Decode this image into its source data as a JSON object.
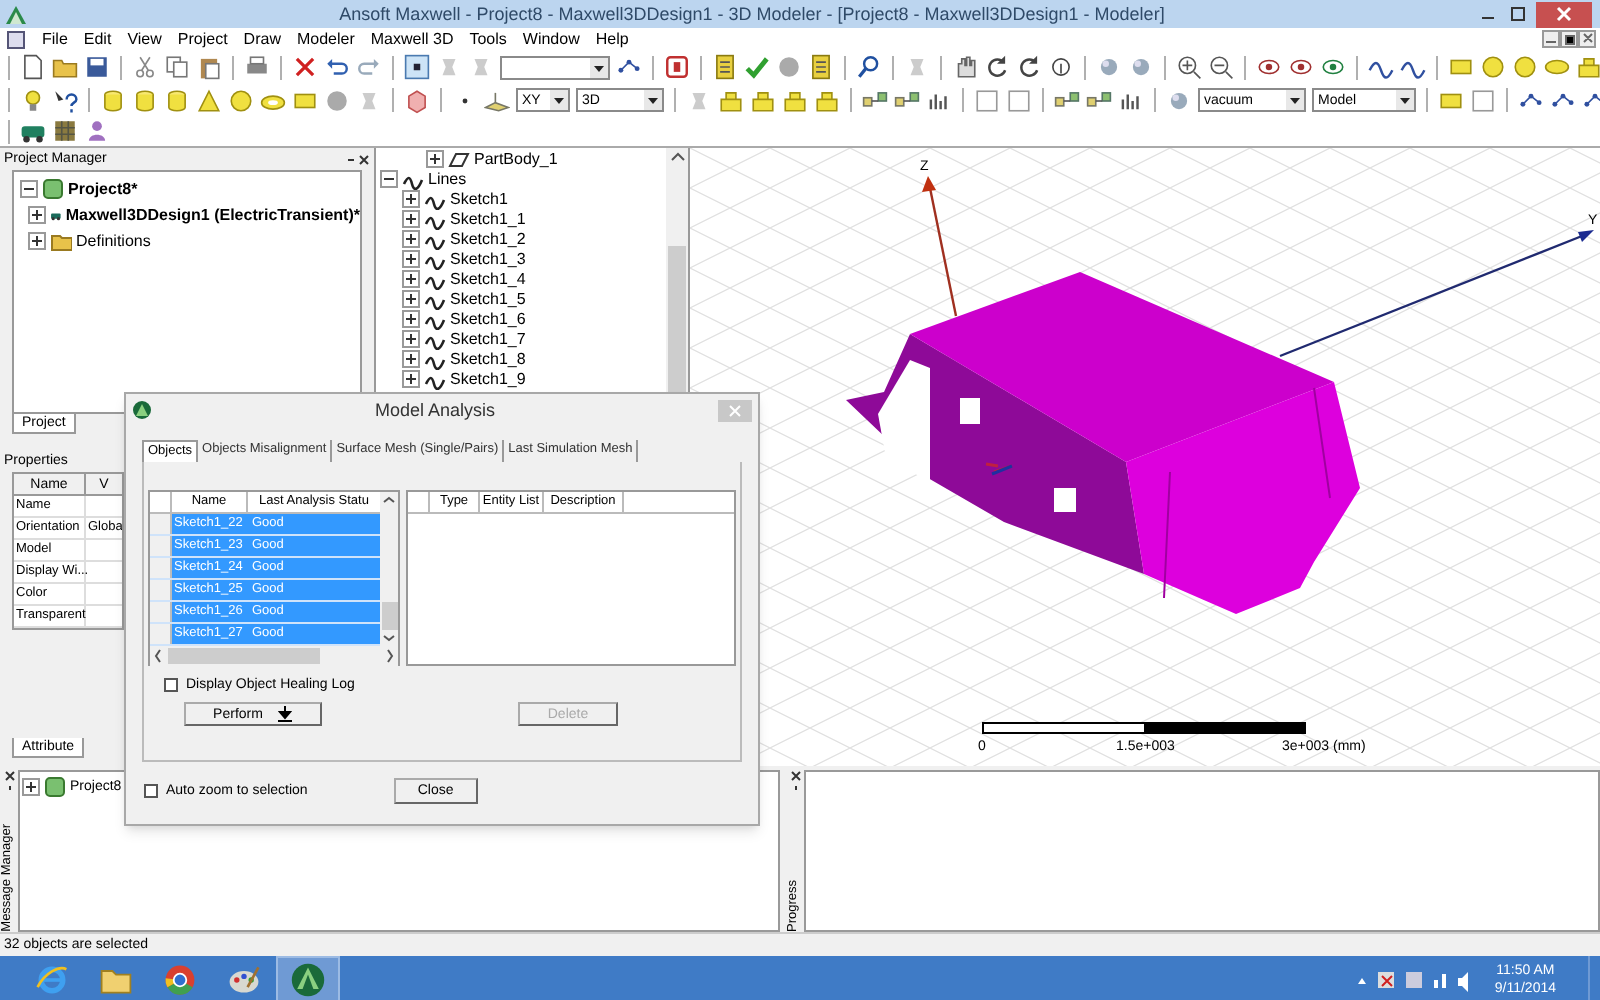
{
  "window": {
    "title": "Ansoft Maxwell  - Project8 - Maxwell3DDesign1 - 3D Modeler - [Project8 - Maxwell3DDesign1 - Modeler]"
  },
  "menu": [
    "File",
    "Edit",
    "View",
    "Project",
    "Draw",
    "Modeler",
    "Maxwell 3D",
    "Tools",
    "Window",
    "Help"
  ],
  "toolbar": {
    "plane": "XY",
    "view": "3D",
    "material": "vacuum",
    "mode": "Model"
  },
  "project_manager": {
    "title": "Project Manager",
    "tab": "Project",
    "tree": [
      {
        "label": "Project8*",
        "expanded": true,
        "children": [
          {
            "label": "Maxwell3DDesign1 (ElectricTransient)*",
            "expanded": false
          },
          {
            "label": "Definitions",
            "expanded": false
          }
        ]
      }
    ]
  },
  "properties": {
    "title": "Properties",
    "columns": [
      "Name",
      "V"
    ],
    "tab": "Attribute",
    "rows": [
      {
        "name": "Name"
      },
      {
        "name": "Orientation",
        "value": "Globa"
      },
      {
        "name": "Model"
      },
      {
        "name": "Display Wi..."
      },
      {
        "name": "Color"
      },
      {
        "name": "Transparent"
      }
    ]
  },
  "model_tree": [
    {
      "kind": "body",
      "label": "PartBody_1",
      "expanded": false
    },
    {
      "kind": "group",
      "label": "Lines",
      "expanded": true,
      "children": [
        {
          "label": "Sketch1",
          "expanded": false
        },
        {
          "label": "Sketch1_1",
          "expanded": false
        },
        {
          "label": "Sketch1_2",
          "expanded": false
        },
        {
          "label": "Sketch1_3",
          "expanded": false
        },
        {
          "label": "Sketch1_4",
          "expanded": false
        },
        {
          "label": "Sketch1_5",
          "expanded": false
        },
        {
          "label": "Sketch1_6",
          "expanded": false
        },
        {
          "label": "Sketch1_7",
          "expanded": false
        },
        {
          "label": "Sketch1_8",
          "expanded": false
        },
        {
          "label": "Sketch1_9",
          "expanded": false
        }
      ]
    }
  ],
  "view": {
    "axes": {
      "z": "Z",
      "y": "Y"
    },
    "scale_bar": [
      "0",
      "1.5e+003",
      "3e+003 (mm)"
    ]
  },
  "dialog": {
    "title": "Model Analysis",
    "tabs": [
      {
        "label": "Objects",
        "selected": true
      },
      {
        "label": "Objects Misalignment",
        "selected": false
      },
      {
        "label": "Surface Mesh (Single/Pairs)",
        "selected": false
      },
      {
        "label": "Last Simulation Mesh",
        "selected": false
      }
    ],
    "objects_table": {
      "columns": [
        "Name",
        "Last Analysis Statu"
      ],
      "rows": [
        {
          "name": "Sketch1_22",
          "status": "Good",
          "selected": true
        },
        {
          "name": "Sketch1_23",
          "status": "Good",
          "selected": true
        },
        {
          "name": "Sketch1_24",
          "status": "Good",
          "selected": true
        },
        {
          "name": "Sketch1_25",
          "status": "Good",
          "selected": true
        },
        {
          "name": "Sketch1_26",
          "status": "Good",
          "selected": true
        },
        {
          "name": "Sketch1_27",
          "status": "Good",
          "selected": true
        }
      ]
    },
    "details_table": {
      "columns": [
        "Type",
        "Entity List",
        "Description"
      ]
    },
    "healing_log": {
      "label": "Display Object Healing Log",
      "checked": false
    },
    "buttons": [
      {
        "label": "Perform",
        "disabled": false
      },
      {
        "label": "Delete",
        "disabled": true
      }
    ],
    "auto_zoom": {
      "label": "Auto zoom to selection",
      "checked": false
    },
    "close_button": "Close"
  },
  "message_manager": {
    "title": "Message Manager",
    "items": [
      {
        "label": "Project8",
        "expanded": false
      }
    ]
  },
  "progress": {
    "title": "Progress"
  },
  "status_bar": "32 objects are selected",
  "taskbar": {
    "apps": [
      {
        "kind": "browser",
        "selected": false
      },
      {
        "kind": "folder",
        "selected": false
      },
      {
        "kind": "chrome",
        "selected": false
      },
      {
        "kind": "paint",
        "selected": false
      },
      {
        "kind": "maxwell",
        "selected": true
      }
    ],
    "time": "11:50 AM",
    "date": "9/11/2014"
  }
}
